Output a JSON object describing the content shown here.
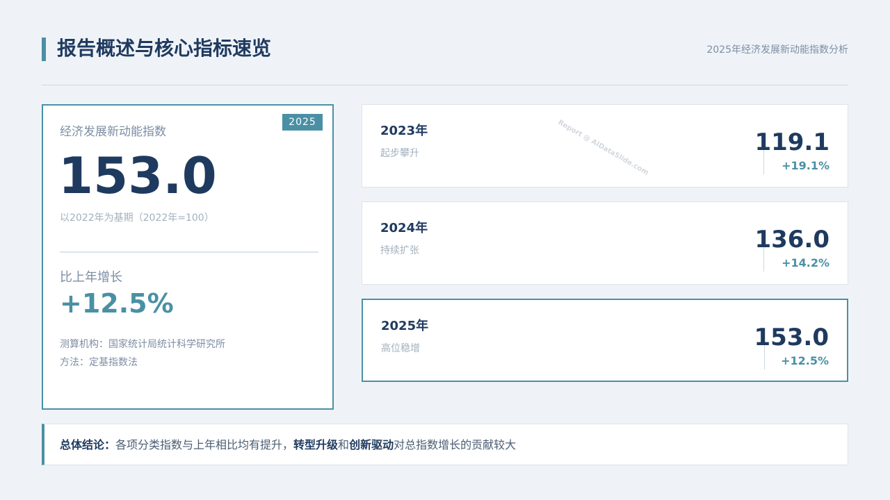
{
  "header": {
    "title": "报告概述与核心指标速览",
    "subtitle": "2025年经济发展新动能指数分析"
  },
  "main_card": {
    "badge": "2025",
    "label": "经济发展新动能指数",
    "value": "153.0",
    "base_note": "以2022年为基期（2022年=100）",
    "growth_label": "比上年增长",
    "growth_value": "+12.5%",
    "agency": "测算机构：国家统计局统计科学研究所",
    "method": "方法：定基指数法"
  },
  "years": [
    {
      "year": "2023年",
      "desc": "起步攀升",
      "value": "119.1",
      "growth": "+19.1%",
      "watermark": "Report @ AIDataSlide.com"
    },
    {
      "year": "2024年",
      "desc": "持续扩张",
      "value": "136.0",
      "growth": "+14.2%"
    },
    {
      "year": "2025年",
      "desc": "高位稳增",
      "value": "153.0",
      "growth": "+12.5%"
    }
  ],
  "conclusion": {
    "prefix": "总体结论：",
    "text1": "各项分类指数与上年相比均有提升，",
    "highlight1": "转型升级",
    "text2": "和",
    "highlight2": "创新驱动",
    "text3": "对总指数增长的贡献较大"
  },
  "colors": {
    "accent": "#4a90a4",
    "navy": "#1f3a5f",
    "background": "#eff3f8"
  }
}
